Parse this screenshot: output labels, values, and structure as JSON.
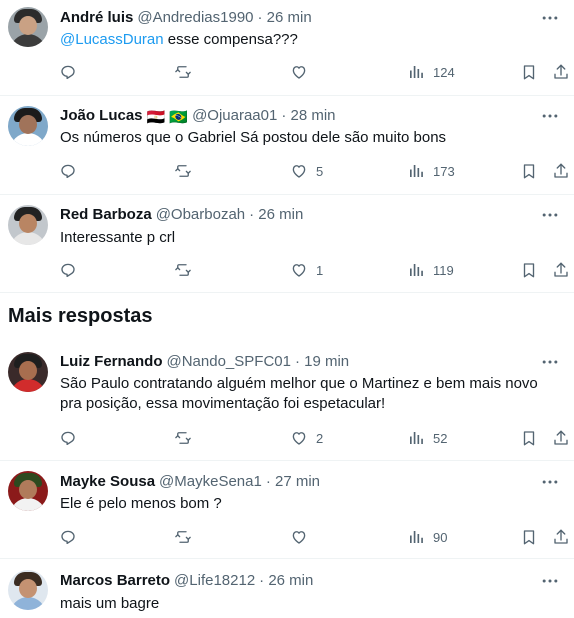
{
  "section": {
    "title": "Mais respostas"
  },
  "tweets": [
    {
      "name": "André luis",
      "handle": "@Andredias1990",
      "time": "· 26 min",
      "mention": "@LucassDuran",
      "text": " esse compensa???",
      "replies": "",
      "retweets": "",
      "likes": "",
      "views": "124",
      "avatar_colors": [
        "#2b2b2b",
        "#c9a184",
        "#3c3c3c",
        "#9aa3a8"
      ]
    },
    {
      "name": "João Lucas",
      "flags": "🇪🇬 🇧🇷",
      "handle": "@Ojuaraa01",
      "time": "· 28 min",
      "text": "Os números que o Gabriel Sá postou dele são muito bons",
      "replies": "",
      "retweets": "",
      "likes": "5",
      "views": "173",
      "avatar_colors": [
        "#1b1b1b",
        "#a0735a",
        "#ffffff",
        "#7fa8c9"
      ]
    },
    {
      "name": "Red Barboza",
      "handle": "@Obarbozah",
      "time": "· 26 min",
      "text": "Interessante p crl",
      "replies": "",
      "retweets": "",
      "likes": "1",
      "views": "119",
      "avatar_colors": [
        "#222222",
        "#b98563",
        "#e7e7e7",
        "#c2c7cc"
      ]
    },
    {
      "name": "Luiz Fernando",
      "handle": "@Nando_SPFC01",
      "time": "· 19 min",
      "text": "São Paulo contratando alguém melhor que o Martinez e bem mais novo pra posição, essa movimentação foi espetacular!",
      "replies": "",
      "retweets": "",
      "likes": "2",
      "views": "52",
      "avatar_colors": [
        "#1e1e1e",
        "#a86e4f",
        "#d12c2c",
        "#3a2a2a"
      ]
    },
    {
      "name": "Mayke Sousa",
      "handle": "@MaykeSena1",
      "time": "· 27 min",
      "text": "Ele é pelo menos bom ?",
      "replies": "",
      "retweets": "",
      "likes": "",
      "views": "90",
      "avatar_colors": [
        "#2d4a1f",
        "#b07b5b",
        "#f2f2f2",
        "#8b1a1a"
      ]
    },
    {
      "name": "Marcos Barreto",
      "handle": "@Life18212",
      "time": "· 26 min",
      "text": "mais um bagre",
      "replies": "",
      "retweets": "",
      "likes": "",
      "views": "",
      "avatar_colors": [
        "#3a2c22",
        "#c49272",
        "#8fb3d9",
        "#dfe7ef"
      ]
    }
  ],
  "icons": {
    "more": "more-icon",
    "reply": "reply-icon",
    "retweet": "retweet-icon",
    "like": "like-icon",
    "views": "views-icon",
    "bookmark": "bookmark-icon",
    "share": "share-icon"
  },
  "colors": {
    "text": "#0f1419",
    "secondary": "#536471",
    "mention": "#1d9bf0",
    "divider": "#eff3f4"
  }
}
